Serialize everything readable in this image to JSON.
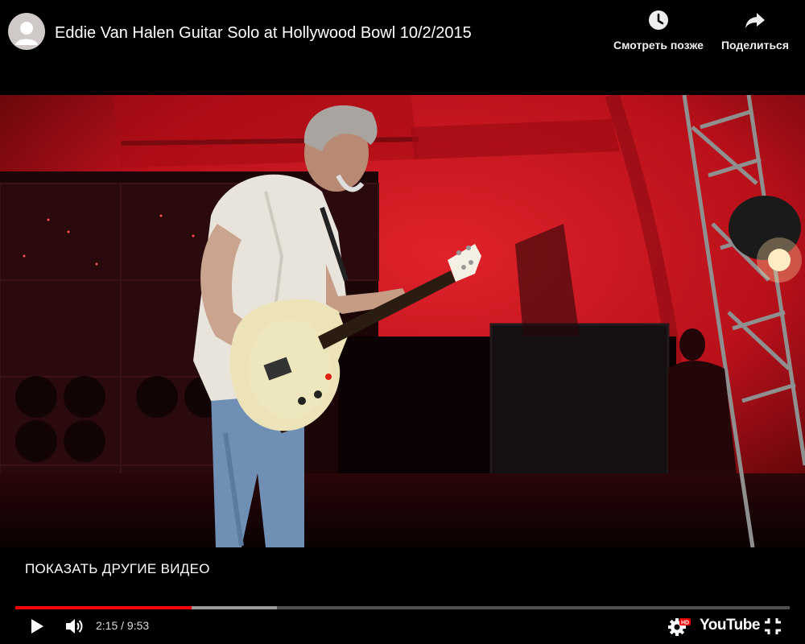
{
  "header": {
    "video_title": "Eddie Van Halen Guitar Solo at Hollywood Bowl 10/2/2015",
    "watch_later_label": "Смотреть позже",
    "share_label": "Поделиться"
  },
  "player": {
    "more_videos_label": "ПОКАЗАТЬ ДРУГИЕ ВИДЕО",
    "current_time": "2:15",
    "duration": "9:53",
    "time_display": "2:15 / 9:53",
    "progress_fraction": 0.228,
    "buffered_fraction": 0.338,
    "brand_logo_text": "YouTube",
    "hd_badge": "HD"
  },
  "colors": {
    "progress_played": "#ff0000",
    "stage_red": "#c8141a",
    "background": "#000000"
  },
  "icons": {
    "watch_later": "clock-icon",
    "share": "share-arrow-icon",
    "play": "play-icon",
    "volume": "volume-icon",
    "settings": "gear-icon",
    "fullscreen": "exit-fullscreen-icon"
  }
}
